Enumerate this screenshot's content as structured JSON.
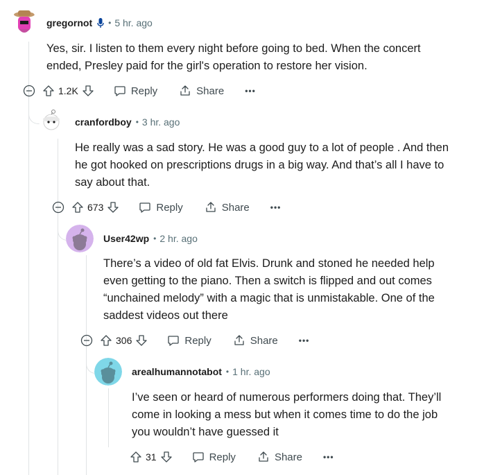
{
  "comments": [
    {
      "username": "gregornot",
      "time": "5 hr. ago",
      "has_mic": true,
      "lines": [
        "Yes, sir. I listen to them every night before going to bed. When the concert",
        "ended, Presley paid for the girl's operation to restore her vision."
      ],
      "votes": "1.2K",
      "avatar_color": "#e23fb4"
    },
    {
      "username": "cranfordboy",
      "time": "3 hr. ago",
      "lines": [
        "He really was a sad story. He was a good guy to a lot of people . And then",
        "he got hooked on prescriptions drugs in a big way. And that’s all I have to",
        "say about that."
      ],
      "votes": "673",
      "avatar_color": "#ffffff"
    },
    {
      "username": "User42wp",
      "time": "2 hr. ago",
      "lines": [
        "There’s a video of old fat Elvis. Drunk and stoned he needed help",
        "even getting to the piano. Then a switch is flipped and out comes",
        "“unchained melody” with a magic that is unmistakable. One of the",
        "saddest videos out there"
      ],
      "votes": "306",
      "avatar_color": "#d5b3ec"
    },
    {
      "username": "arealhumannotabot",
      "time": "1 hr. ago",
      "lines": [
        "I’ve seen or heard of numerous performers doing that. They’ll",
        "come in looking a mess but when it comes time to do the job",
        "you wouldn’t have guessed it"
      ],
      "votes": "31",
      "avatar_color": "#7fd7e8"
    }
  ],
  "labels": {
    "reply": "Reply",
    "share": "Share",
    "more": "•••"
  }
}
